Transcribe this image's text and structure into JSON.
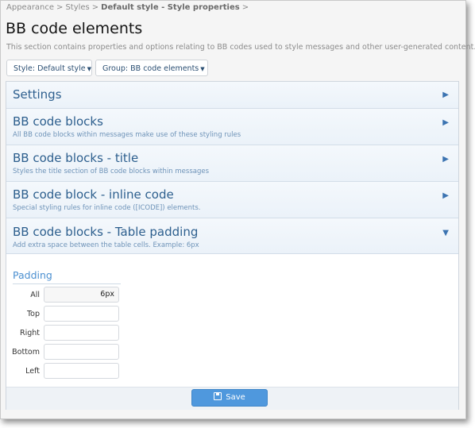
{
  "breadcrumb": {
    "items": [
      "Appearance",
      "Styles",
      "Default style - Style properties"
    ],
    "separator": ">"
  },
  "page": {
    "title": "BB code elements",
    "description": "This section contains properties and options relating to BB codes used to style messages and other user-generated content."
  },
  "filters": {
    "style_label": "Style: Default style",
    "group_label": "Group: BB code elements"
  },
  "sections": [
    {
      "title": "Settings",
      "description": "",
      "state": "collapsed"
    },
    {
      "title": "BB code blocks",
      "description": "All BB code blocks within messages make use of these styling rules",
      "state": "collapsed"
    },
    {
      "title": "BB code blocks - title",
      "description": "Styles the title section of BB code blocks within messages",
      "state": "collapsed"
    },
    {
      "title": "BB code block - inline code",
      "description": "Special styling rules for inline code ([ICODE]) elements.",
      "state": "collapsed"
    },
    {
      "title": "BB code blocks - Table padding",
      "description": "Add extra space between the table cells. Example: 6px",
      "state": "expanded"
    }
  ],
  "padding": {
    "group_title": "Padding",
    "fields": [
      {
        "label": "All",
        "value": "6px"
      },
      {
        "label": "Top",
        "value": ""
      },
      {
        "label": "Right",
        "value": ""
      },
      {
        "label": "Bottom",
        "value": ""
      },
      {
        "label": "Left",
        "value": ""
      }
    ]
  },
  "submit": {
    "save_label": "Save"
  },
  "icons": {
    "collapsed": "triangle-right-icon",
    "expanded": "triangle-down-icon",
    "save": "save-icon"
  },
  "colors": {
    "accent": "#4f98dd",
    "section_title": "#2d5f8e",
    "section_bg": "#edf3fa"
  }
}
